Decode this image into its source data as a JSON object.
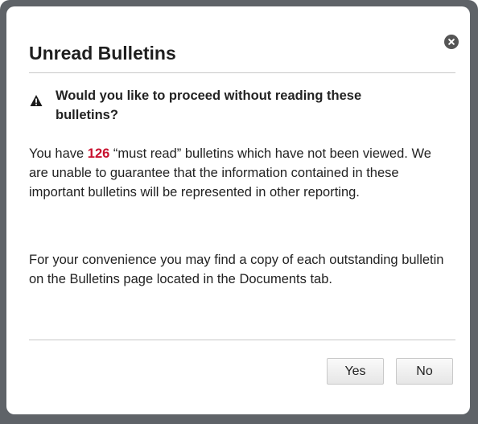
{
  "dialog": {
    "title": "Unread Bulletins",
    "close_icon": "close-icon",
    "warning_icon": "warning-triangle-icon",
    "warning_text": "Would you like to proceed without reading these bulletins?",
    "paragraph1": {
      "prefix": "You have ",
      "count": "126",
      "suffix": " “must read” bulletins which have not been viewed. We are unable to guarantee that the information contained in these important bulletins will be represented in other reporting."
    },
    "paragraph2": "For your convenience you may find a copy of each outstanding bulletin on the Bulletins page located in the Documents tab.",
    "yes_label": "Yes",
    "no_label": "No"
  },
  "colors": {
    "count_highlight": "#c8102e",
    "frame_background": "#5f6368",
    "dialog_background": "#ffffff"
  }
}
